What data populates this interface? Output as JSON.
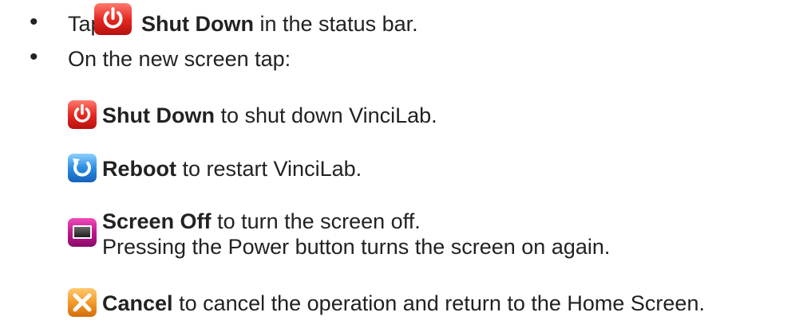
{
  "bullets": {
    "tap": {
      "prefix": "Tap",
      "bold": "Shut Down",
      "suffix": "in the status bar.",
      "icon": "power-icon"
    },
    "on_new_screen": "On the new screen tap:"
  },
  "options": [
    {
      "icon": "power-icon",
      "bold": "Shut Down",
      "text": "to shut down VinciLab."
    },
    {
      "icon": "reboot-icon",
      "bold": "Reboot",
      "text": "to restart VinciLab."
    },
    {
      "icon": "screen-off-icon",
      "bold": "Screen Off",
      "text": "to turn the screen off.",
      "note": "Pressing the Power button turns the screen on again."
    },
    {
      "icon": "cancel-icon",
      "bold": "Cancel",
      "text": "to cancel the operation and return to the Home Screen."
    }
  ],
  "colors": {
    "power_red": "#d9211f",
    "reboot_blue": "#1f7fd6",
    "screen_off_magenta": "#b0127f",
    "cancel_orange": "#f08a1e"
  }
}
